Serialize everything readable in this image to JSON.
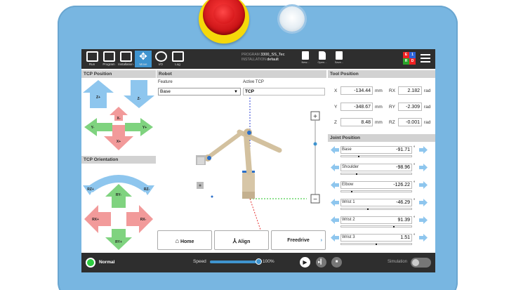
{
  "topbar": {
    "items": [
      {
        "label": "Run",
        "icon": "run-icon"
      },
      {
        "label": "Program",
        "icon": "program-icon"
      },
      {
        "label": "Installation",
        "icon": "installation-icon"
      },
      {
        "label": "Move",
        "icon": "move-icon"
      },
      {
        "label": "I/O",
        "icon": "io-icon"
      },
      {
        "label": "Log",
        "icon": "log-icon"
      }
    ],
    "program_label": "PROGRAM",
    "program_value": "3300_SS_Tec",
    "installation_label": "INSTALLATION",
    "installation_value": "default",
    "file_buttons": [
      {
        "label": "New..."
      },
      {
        "label": "Open..."
      },
      {
        "label": "Save..."
      }
    ]
  },
  "tcp_position": {
    "title": "TCP Position",
    "labels": {
      "z_plus": "Z+",
      "z_minus": "Z-",
      "x_minus": "X-",
      "x_plus": "X+",
      "y_minus": "Y-",
      "y_plus": "Y+"
    }
  },
  "tcp_orientation": {
    "title": "TCP Orientation",
    "labels": {
      "rz_plus": "RZ+",
      "rz_minus": "RZ-",
      "ry_minus": "RY-",
      "ry_plus": "RY+",
      "rx_plus": "RX+",
      "rx_minus": "RX-"
    }
  },
  "robot": {
    "title": "Robot",
    "feature_label": "Feature",
    "feature_value": "Base",
    "active_tcp_label": "Active TCP",
    "active_tcp_value": "TCP",
    "zoom_in": "+",
    "zoom_out": "−"
  },
  "tool_position": {
    "title": "Tool Position",
    "rows": [
      {
        "axis": "X",
        "value": "-134.44",
        "unit": "mm",
        "raxis": "RX",
        "rvalue": "2.182",
        "runit": "rad"
      },
      {
        "axis": "Y",
        "value": "-348.67",
        "unit": "mm",
        "raxis": "RY",
        "rvalue": "-2.309",
        "runit": "rad"
      },
      {
        "axis": "Z",
        "value": "8.48",
        "unit": "mm",
        "raxis": "RZ",
        "rvalue": "-0.001",
        "runit": "rad"
      }
    ]
  },
  "joint_position": {
    "title": "Joint Position",
    "unit": "°",
    "joints": [
      {
        "name": "Base",
        "value": "-91.71",
        "level": 0.25
      },
      {
        "name": "Shoulder",
        "value": "-98.96",
        "level": 0.22
      },
      {
        "name": "Elbow",
        "value": "-126.22",
        "level": 0.15
      },
      {
        "name": "Wrist 1",
        "value": "-46.29",
        "level": 0.38
      },
      {
        "name": "Wrist 2",
        "value": "91.39",
        "level": 0.75
      },
      {
        "name": "Wrist 3",
        "value": "1.51",
        "level": 0.5
      }
    ]
  },
  "actions": {
    "home": "Home",
    "align": "Align",
    "freedrive": "Freedrive"
  },
  "bottombar": {
    "status": "Normal",
    "speed_label": "Speed",
    "speed_value": "100%",
    "speed_level": 1.0,
    "simulation_label": "Simulation"
  },
  "colors": {
    "accent": "#3f94cf",
    "arrow_blue": "#8ec6ee",
    "arrow_green": "#7fd37f",
    "arrow_red": "#f29a9a",
    "status_green": "#2ecc40"
  }
}
